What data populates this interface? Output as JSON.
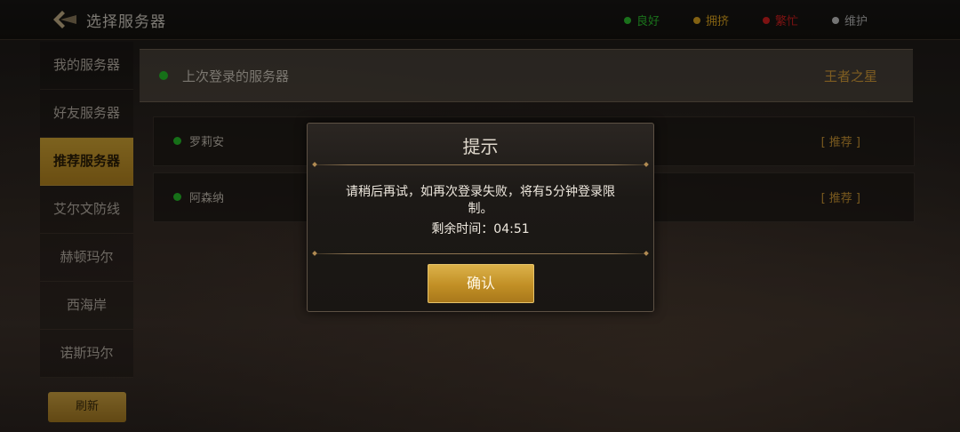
{
  "topbar": {
    "title": "选择服务器",
    "legend": [
      {
        "label": "良好",
        "color": "#2ec32f"
      },
      {
        "label": "拥挤",
        "color": "#e0a820"
      },
      {
        "label": "繁忙",
        "color": "#d82020"
      },
      {
        "label": "维护",
        "color": "#c8c8c8"
      }
    ]
  },
  "sidebar": {
    "items": [
      {
        "label": "我的服务器"
      },
      {
        "label": "好友服务器"
      },
      {
        "label": "推荐服务器",
        "active": true
      },
      {
        "label": "艾尔文防线"
      },
      {
        "label": "赫顿玛尔"
      },
      {
        "label": "西海岸"
      },
      {
        "label": "诺斯玛尔"
      }
    ],
    "refresh_label": "刷新"
  },
  "last_login": {
    "label": "上次登录的服务器",
    "server": "王者之星"
  },
  "servers": [
    {
      "name": "罗莉安",
      "tag": "[ 推荐 ]"
    },
    {
      "name": "阿森纳",
      "tag": "[ 推荐 ]"
    }
  ],
  "dialog": {
    "title": "提示",
    "message": "请稍后再试，如再次登录失败，将有5分钟登录限制。",
    "timer": "剩余时间：04:51",
    "confirm_label": "确认"
  },
  "colors": {
    "accent_gold": "#c8951f",
    "status_green": "#27c22a"
  }
}
